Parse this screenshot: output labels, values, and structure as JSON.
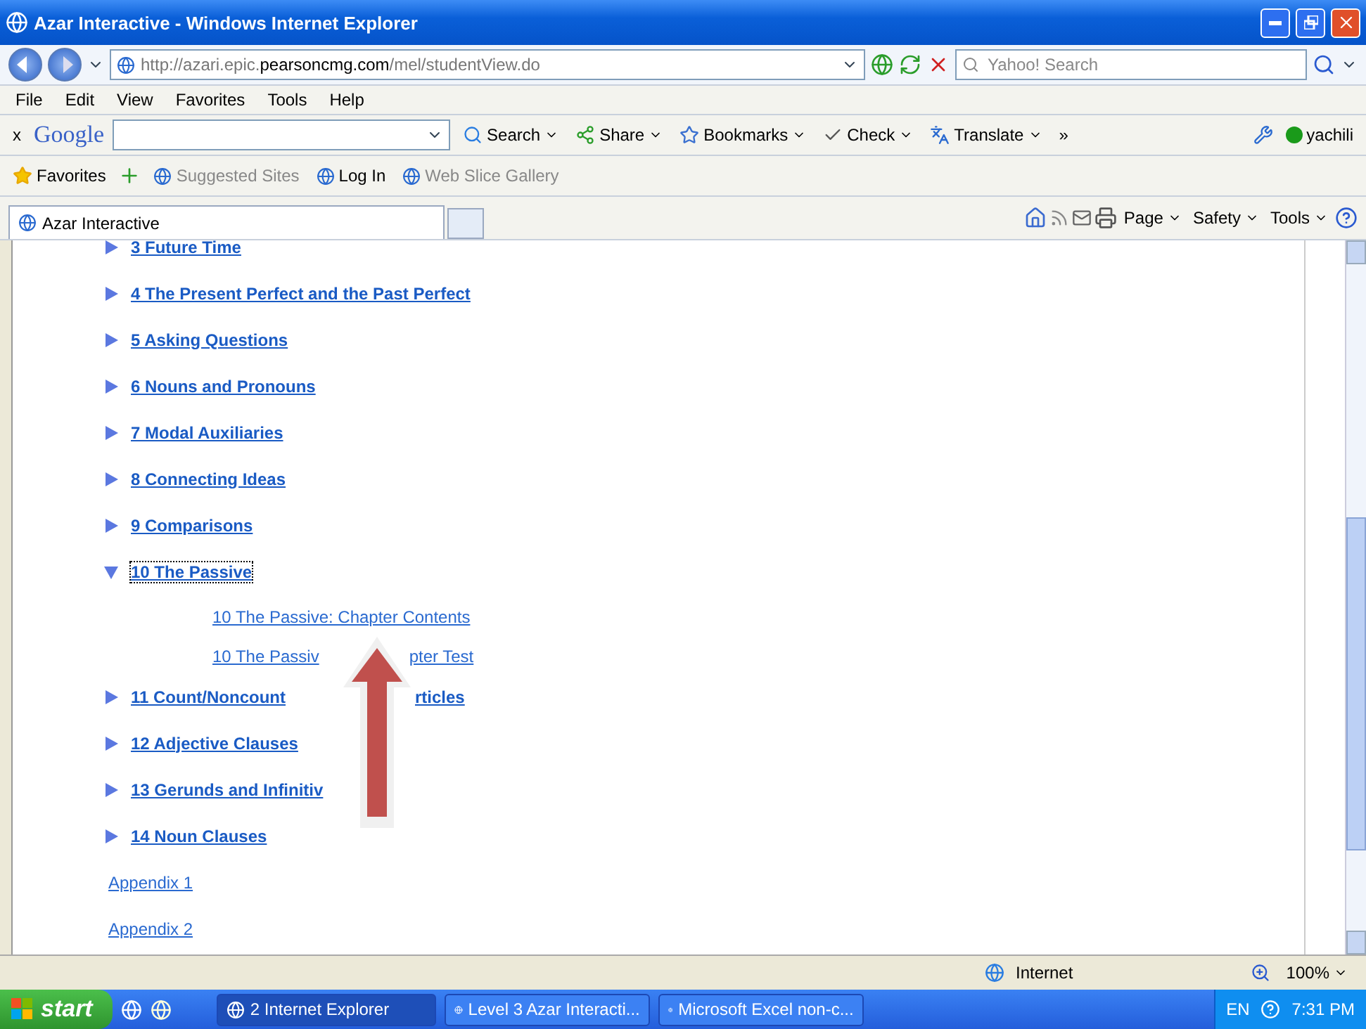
{
  "window": {
    "title": "Azar Interactive - Windows Internet Explorer"
  },
  "address_bar": {
    "url_prefix": "http://azari.epic.",
    "url_domain": "pearsoncmg.com",
    "url_path": "/mel/studentView.do",
    "search_placeholder": "Yahoo! Search"
  },
  "menu": [
    "File",
    "Edit",
    "View",
    "Favorites",
    "Tools",
    "Help"
  ],
  "google_toolbar": {
    "close": "x",
    "logo": "Google",
    "buttons": [
      {
        "kind": "search",
        "label": "Search"
      },
      {
        "kind": "share",
        "label": "Share"
      },
      {
        "kind": "bookmarks",
        "label": "Bookmarks"
      },
      {
        "kind": "check",
        "label": "Check"
      },
      {
        "kind": "translate",
        "label": "Translate"
      }
    ],
    "more": "»",
    "user": "yachili"
  },
  "favorites_bar": {
    "favorites": "Favorites",
    "links": [
      {
        "label": "Suggested Sites",
        "disabled": true
      },
      {
        "label": "Log In",
        "disabled": false
      },
      {
        "label": "Web Slice Gallery",
        "disabled": true
      }
    ]
  },
  "tabs": [
    {
      "label": "Azar Interactive",
      "selected": true
    }
  ],
  "command_bar": [
    "Page",
    "Safety",
    "Tools"
  ],
  "chapters": [
    {
      "label": "3 Future Time",
      "expanded": false,
      "focused": false
    },
    {
      "label": "4 The Present Perfect and the Past Perfect",
      "expanded": false,
      "focused": false
    },
    {
      "label": "5 Asking Questions",
      "expanded": false,
      "focused": false
    },
    {
      "label": "6 Nouns and Pronouns",
      "expanded": false,
      "focused": false
    },
    {
      "label": "7 Modal Auxiliaries",
      "expanded": false,
      "focused": false
    },
    {
      "label": "8 Connecting Ideas",
      "expanded": false,
      "focused": false
    },
    {
      "label": "9 Comparisons",
      "expanded": false,
      "focused": false
    },
    {
      "label": "10 The Passive",
      "expanded": true,
      "focused": true,
      "children": [
        {
          "label": "10 The Passive: Chapter Contents"
        },
        {
          "label": "10 The Passiv",
          "text_after_arrow": "pter Test"
        }
      ]
    },
    {
      "label": "11 Count/Noncount",
      "text_after_arrow": "rticles",
      "expanded": false,
      "focused": false
    },
    {
      "label": "12 Adjective Clauses",
      "expanded": false,
      "focused": false
    },
    {
      "label": "13 Gerunds and Infinitiv",
      "expanded": false,
      "focused": false
    },
    {
      "label": "14 Noun Clauses",
      "expanded": false,
      "focused": false
    }
  ],
  "appendices": [
    "Appendix 1",
    "Appendix 2"
  ],
  "status_bar": {
    "zone": "Internet",
    "zoom": "100%"
  },
  "taskbar": {
    "start": "start",
    "windows": [
      {
        "label": "2 Internet Explorer",
        "selected": true
      },
      {
        "label": "Level 3 Azar Interacti...",
        "selected": false
      },
      {
        "label": "Microsoft Excel non-c...",
        "selected": false
      }
    ],
    "language": "EN",
    "time": "7:31 PM"
  }
}
